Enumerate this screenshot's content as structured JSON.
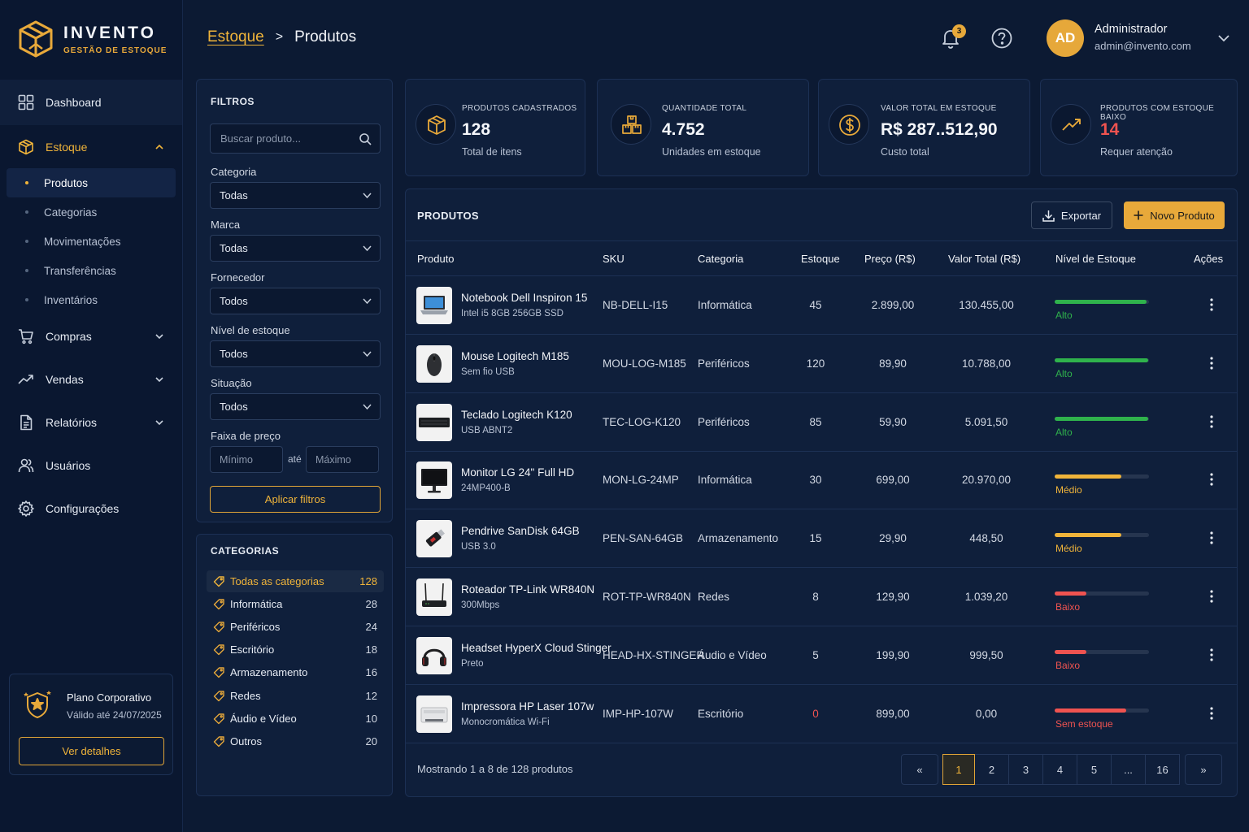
{
  "brand": {
    "name": "INVENTO",
    "tagline": "GESTÃO DE ESTOQUE"
  },
  "colors": {
    "accent": "#e8a93a",
    "background": "#0c1a33",
    "panel": "#0f1f3b",
    "high": "#2fb24c",
    "medium": "#f0b43a",
    "low": "#ef5350"
  },
  "sidebar": {
    "items": [
      {
        "label": "Dashboard",
        "icon": "grid-icon"
      },
      {
        "label": "Estoque",
        "icon": "box-icon",
        "expanded": true
      },
      {
        "label": "Compras",
        "icon": "cart-icon"
      },
      {
        "label": "Vendas",
        "icon": "trend-icon"
      },
      {
        "label": "Relatórios",
        "icon": "document-icon"
      },
      {
        "label": "Usuários",
        "icon": "users-icon"
      },
      {
        "label": "Configurações",
        "icon": "gear-icon"
      }
    ],
    "subitems": [
      "Produtos",
      "Categorias",
      "Movimentações",
      "Transferências",
      "Inventários"
    ],
    "plan": {
      "title": "Plano Corporativo",
      "valid": "Válido até 24/07/2025",
      "button": "Ver detalhes"
    }
  },
  "header": {
    "breadcrumb_link": "Estoque",
    "breadcrumb_sep": ">",
    "breadcrumb_current": "Produtos",
    "notifications": "3",
    "user": {
      "initials": "AD",
      "name": "Administrador",
      "email": "admin@invento.com"
    }
  },
  "filters": {
    "title": "FILTROS",
    "search_placeholder": "Buscar produto...",
    "fields": [
      {
        "label": "Categoria",
        "value": "Todas"
      },
      {
        "label": "Marca",
        "value": "Todas"
      },
      {
        "label": "Fornecedor",
        "value": "Todos"
      },
      {
        "label": "Nível de estoque",
        "value": "Todos"
      },
      {
        "label": "Situação",
        "value": "Todos"
      }
    ],
    "price_label": "Faixa de preço",
    "min_placeholder": "Mínimo",
    "between": "até",
    "max_placeholder": "Máximo",
    "apply": "Aplicar filtros"
  },
  "categories": {
    "title": "CATEGORIAS",
    "items": [
      {
        "label": "Todas as categorias",
        "count": "128"
      },
      {
        "label": "Informática",
        "count": "28"
      },
      {
        "label": "Periféricos",
        "count": "24"
      },
      {
        "label": "Escritório",
        "count": "18"
      },
      {
        "label": "Armazenamento",
        "count": "16"
      },
      {
        "label": "Redes",
        "count": "12"
      },
      {
        "label": "Áudio e Vídeo",
        "count": "10"
      },
      {
        "label": "Outros",
        "count": "20"
      }
    ]
  },
  "stats": [
    {
      "label": "PRODUTOS CADASTRADOS",
      "value": "128",
      "sub": "Total de itens",
      "icon": "package-icon"
    },
    {
      "label": "QUANTIDADE TOTAL",
      "value": "4.752",
      "sub": "Unidades em estoque",
      "icon": "boxes-icon"
    },
    {
      "label": "VALOR TOTAL EM ESTOQUE",
      "value": "R$ 287..512,90",
      "sub": "Custo total",
      "icon": "dollar-icon"
    },
    {
      "label": "PRODUTOS COM ESTOQUE BAIXO",
      "value": "14",
      "sub": "Requer atenção",
      "icon": "trend-up-icon"
    }
  ],
  "products": {
    "title": "PRODUTOS",
    "export": "Exportar",
    "new": "Novo Produto",
    "columns": [
      "Produto",
      "SKU",
      "Categoria",
      "Estoque",
      "Preço (R$)",
      "Valor Total (R$)",
      "Nível de Estoque",
      "Ações"
    ],
    "rows": [
      {
        "name": "Notebook Dell Inspiron 15",
        "desc": "Intel i5 8GB 256GB SSD",
        "sku": "NB-DELL-I15",
        "category": "Informática",
        "stock": "45",
        "price": "2.899,00",
        "total": "130.455,00",
        "level": "Alto",
        "level_fraction": 0.97,
        "image": "laptop-image"
      },
      {
        "name": "Mouse Logitech M185",
        "desc": "Sem fio USB",
        "sku": "MOU-LOG-M185",
        "category": "Periféricos",
        "stock": "120",
        "price": "89,90",
        "total": "10.788,00",
        "level": "Alto",
        "level_fraction": 0.99,
        "image": "mouse-image"
      },
      {
        "name": "Teclado Logitech K120",
        "desc": "USB ABNT2",
        "sku": "TEC-LOG-K120",
        "category": "Periféricos",
        "stock": "85",
        "price": "59,90",
        "total": "5.091,50",
        "level": "Alto",
        "level_fraction": 0.99,
        "image": "keyboard-image"
      },
      {
        "name": "Monitor LG 24\" Full HD",
        "desc": "24MP400-B",
        "sku": "MON-LG-24MP",
        "category": "Informática",
        "stock": "30",
        "price": "699,00",
        "total": "20.970,00",
        "level": "Médio",
        "level_fraction": 0.71,
        "image": "monitor-image"
      },
      {
        "name": "Pendrive SanDisk 64GB",
        "desc": "USB 3.0",
        "sku": "PEN-SAN-64GB",
        "category": "Armazenamento",
        "stock": "15",
        "price": "29,90",
        "total": "448,50",
        "level": "Médio",
        "level_fraction": 0.71,
        "image": "usb-drive-image"
      },
      {
        "name": "Roteador TP-Link WR840N",
        "desc": "300Mbps",
        "sku": "ROT-TP-WR840N",
        "category": "Redes",
        "stock": "8",
        "price": "129,90",
        "total": "1.039,20",
        "level": "Baixo",
        "level_fraction": 0.34,
        "image": "router-image"
      },
      {
        "name": "Headset HyperX Cloud Stinger",
        "desc": "Preto",
        "sku": "HEAD-HX-STINGER",
        "category": "Áudio e Vídeo",
        "stock": "5",
        "price": "199,90",
        "total": "999,50",
        "level": "Baixo",
        "level_fraction": 0.34,
        "image": "headset-image"
      },
      {
        "name": "Impressora HP Laser 107w",
        "desc": "Monocromática Wi-Fi",
        "sku": "IMP-HP-107W",
        "category": "Escritório",
        "stock": "0",
        "price": "899,00",
        "total": "0,00",
        "level": "Sem estoque",
        "level_fraction": 0.76,
        "image": "printer-image"
      }
    ],
    "footer": "Mostrando 1 a 8 de 128 produtos",
    "pages": [
      "1",
      "2",
      "3",
      "4",
      "5",
      "...",
      "16"
    ],
    "prev": "«",
    "next": "»"
  }
}
